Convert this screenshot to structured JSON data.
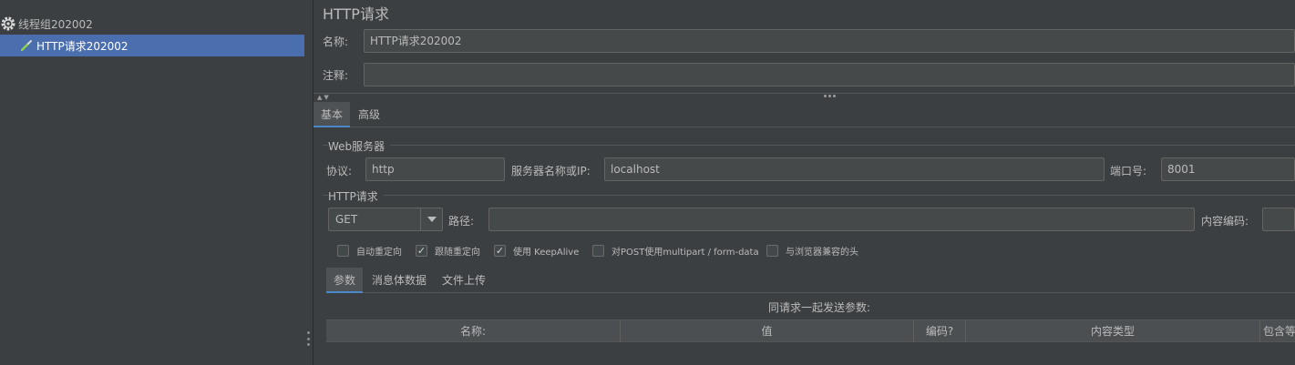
{
  "tree": {
    "thread_group": "线程组202002",
    "http_sampler": "HTTP请求202002"
  },
  "panel": {
    "title": "HTTP请求",
    "name_label": "名称:",
    "name_value": "HTTP请求202002",
    "comment_label": "注释:",
    "comment_value": "",
    "tabs": [
      "基本",
      "高级"
    ],
    "web_server": {
      "group_title": "Web服务器",
      "protocol_label": "协议:",
      "protocol_value": "http",
      "server_label": "服务器名称或IP:",
      "server_value": "localhost",
      "port_label": "端口号:",
      "port_value": "8001"
    },
    "http_request": {
      "group_title": "HTTP请求",
      "method": "GET",
      "path_label": "路径:",
      "path_value": "",
      "encoding_label": "内容编码:",
      "encoding_value": ""
    },
    "options": [
      {
        "label": "自动重定向",
        "checked": false
      },
      {
        "label": "跟随重定向",
        "checked": true
      },
      {
        "label": "使用 KeepAlive",
        "checked": true
      },
      {
        "label": "对POST使用multipart / form-data",
        "checked": false
      },
      {
        "label": "与浏览器兼容的头",
        "checked": false
      }
    ],
    "sub_tabs": [
      "参数",
      "消息体数据",
      "文件上传"
    ],
    "params_caption": "同请求一起发送参数:",
    "table_headers": [
      "名称:",
      "值",
      "编码?",
      "内容类型",
      "包含等"
    ]
  },
  "colors": {
    "background": "#3c3f41",
    "selection": "#4b6eaf",
    "field": "#45494a",
    "text": "#bbbbbb"
  }
}
